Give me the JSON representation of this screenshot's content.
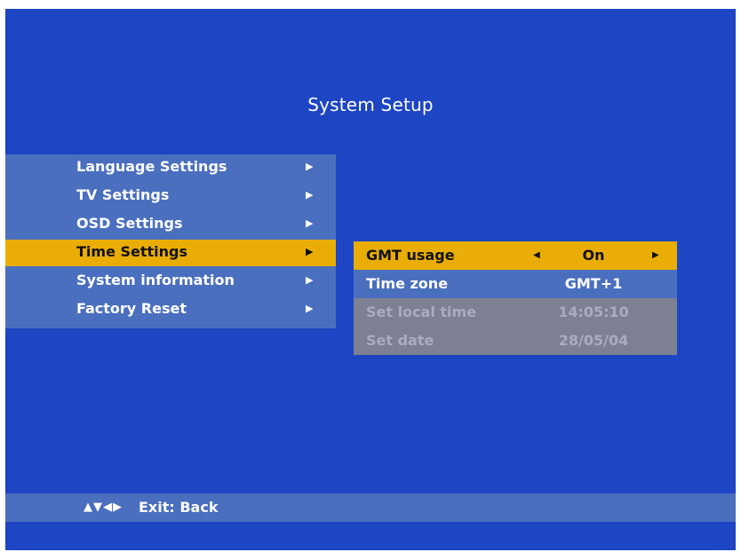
{
  "screen": {
    "title": "System Setup"
  },
  "main_menu": {
    "items": [
      {
        "label": "Language Settings",
        "arrow": "▶"
      },
      {
        "label": "TV Settings",
        "arrow": "▶"
      },
      {
        "label": "OSD Settings",
        "arrow": "▶"
      },
      {
        "label": "Time Settings",
        "arrow": "▶"
      },
      {
        "label": "System information",
        "arrow": "▶"
      },
      {
        "label": "Factory Reset",
        "arrow": "▶"
      }
    ],
    "selected_index": 3
  },
  "time_settings": {
    "gmt_usage": {
      "label": "GMT usage",
      "value": "On",
      "left_arrow": "◀",
      "right_arrow": "▶"
    },
    "time_zone": {
      "label": "Time zone",
      "value": "GMT+1"
    },
    "local_time": {
      "label": "Set local time",
      "value": "14:05:10"
    },
    "date": {
      "label": "Set date",
      "value": "28/05/04"
    }
  },
  "help_bar": {
    "icons": "▲▼◀▶",
    "text": "Exit: Back"
  },
  "colors": {
    "background": "#1d45c4",
    "panel": "#4a6fbf",
    "highlight": "#e9ad06",
    "disabled": "#7d7f92"
  }
}
